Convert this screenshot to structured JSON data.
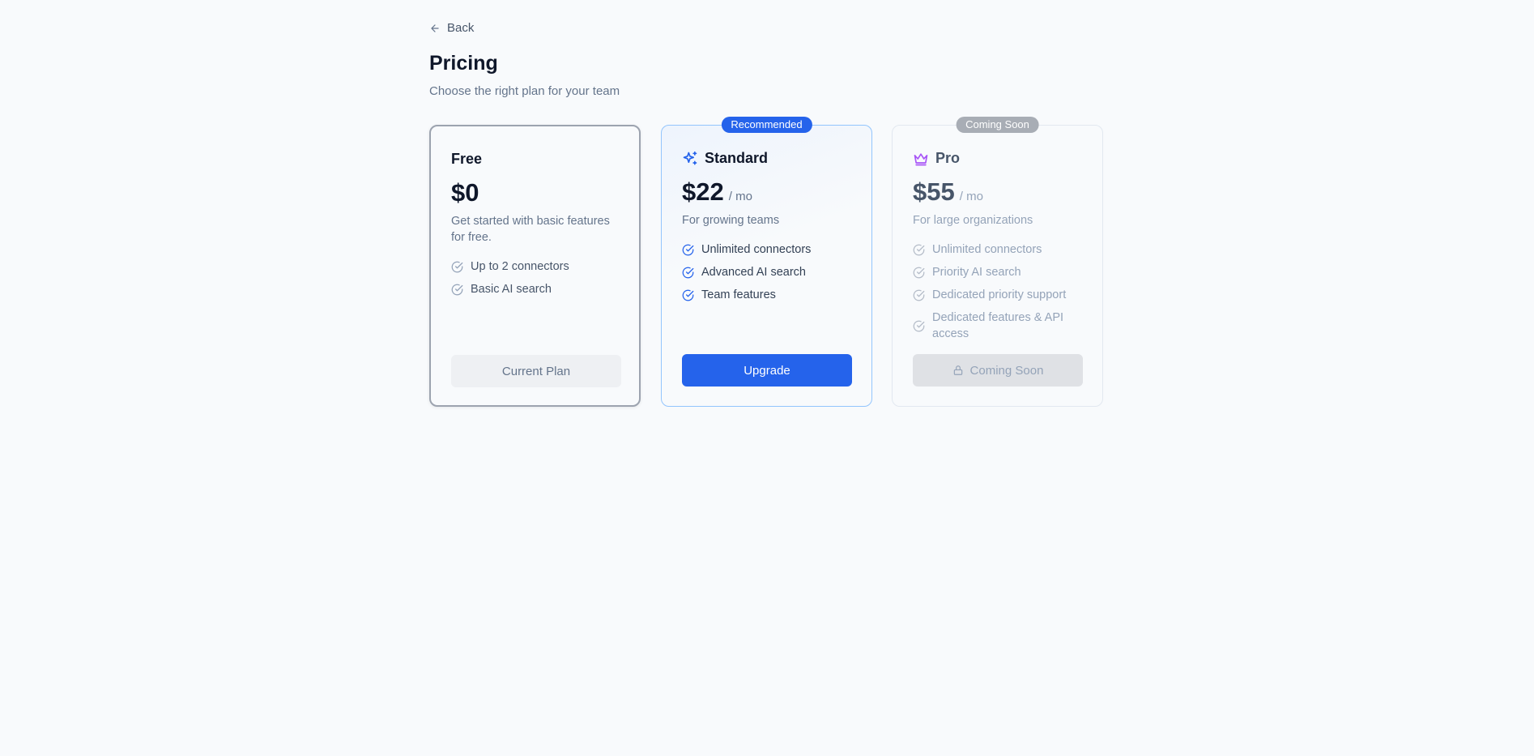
{
  "nav": {
    "back_label": "Back"
  },
  "header": {
    "title": "Pricing",
    "subtitle": "Choose the right plan for your team"
  },
  "plans": [
    {
      "name": "Free",
      "price": "$0",
      "period": "",
      "description": "Get started with basic features for free.",
      "features": [
        "Up to 2 connectors",
        "Basic AI search"
      ],
      "button_label": "Current Plan",
      "badge": ""
    },
    {
      "name": "Standard",
      "price": "$22",
      "period": "/ mo",
      "description": "For growing teams",
      "features": [
        "Unlimited connectors",
        "Advanced AI search",
        "Team features"
      ],
      "button_label": "Upgrade",
      "badge": "Recommended",
      "icon": "sparkles-icon"
    },
    {
      "name": "Pro",
      "price": "$55",
      "period": "/ mo",
      "description": "For large organizations",
      "features": [
        "Unlimited connectors",
        "Priority AI search",
        "Dedicated priority support",
        "Dedicated features & API access"
      ],
      "button_label": "Coming Soon",
      "badge": "Coming Soon",
      "icon": "crown-icon"
    }
  ],
  "colors": {
    "accent": "#2563eb",
    "pro_icon": "#a855f7",
    "background": "#f8fafc"
  }
}
